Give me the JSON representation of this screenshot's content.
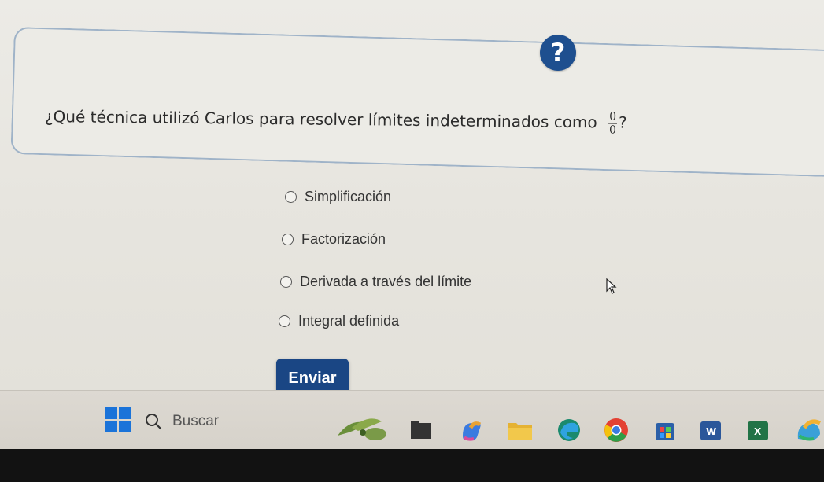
{
  "question": {
    "help_icon": "?",
    "text": "¿Qué técnica utilizó Carlos para resolver límites indeterminados como",
    "fraction_numerator": "0",
    "fraction_denominator": "0",
    "suffix": "?"
  },
  "options": [
    {
      "label": "Simplificación",
      "selected": false
    },
    {
      "label": "Factorización",
      "selected": false
    },
    {
      "label": "Derivada a través del límite",
      "selected": false
    },
    {
      "label": "Integral definida",
      "selected": false
    }
  ],
  "submit_label": "Enviar",
  "taskbar": {
    "search_placeholder": "Buscar",
    "apps": [
      "widgets-icon",
      "file-explorer-icon",
      "copilot-icon",
      "folder-icon",
      "edge-icon",
      "chrome-icon",
      "store-icon",
      "word-icon",
      "excel-icon",
      "app-icon"
    ]
  },
  "colors": {
    "accent": "#1a4684",
    "help_badge": "#1e4f8f",
    "card_border": "#9fb3c8",
    "start_blue": "#1a73d9"
  }
}
